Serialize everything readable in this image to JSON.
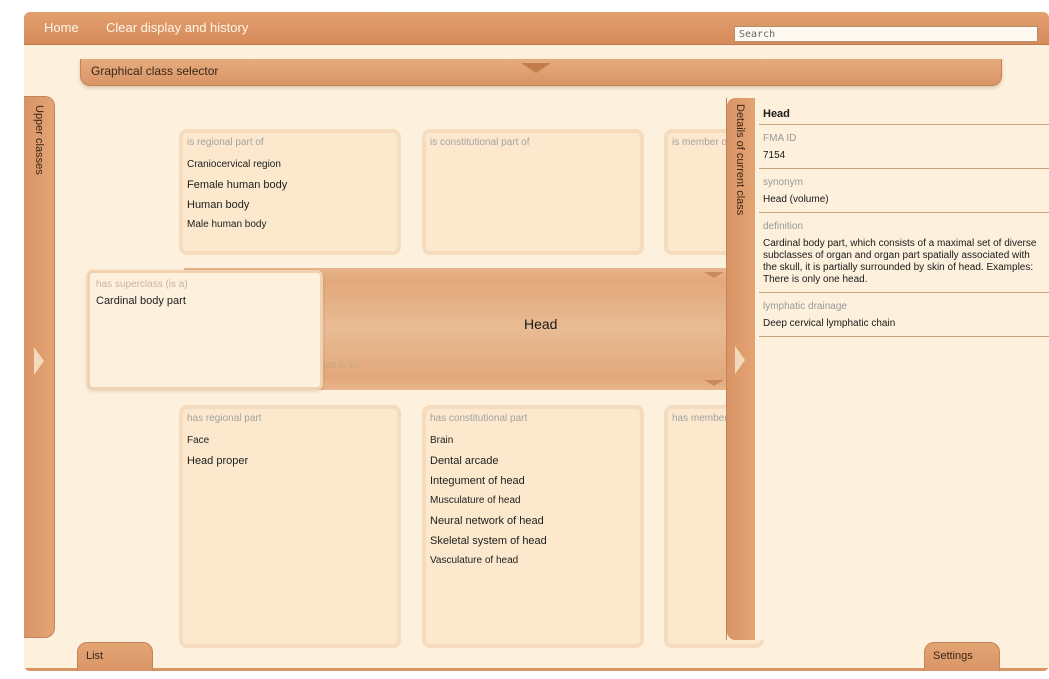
{
  "nav": {
    "home": "Home",
    "clear": "Clear display and history"
  },
  "search": {
    "placeholder": "Search"
  },
  "selector": {
    "label": "Graphical class selector"
  },
  "upper_classes": {
    "label": "Upper classes"
  },
  "top_panels": [
    {
      "title": "is regional part of",
      "items": [
        "Craniocervical region",
        "Female human body",
        "Human body",
        "Male human body"
      ]
    },
    {
      "title": "is constitutional part of",
      "items": []
    },
    {
      "title": "is member of",
      "items": []
    }
  ],
  "bottom_panels": [
    {
      "title": "has regional part",
      "items": [
        "Face",
        "Head proper"
      ]
    },
    {
      "title": "has constitutional part",
      "items": [
        "Brain",
        "Dental arcade",
        "Integument of head",
        "Musculature of head",
        "Neural network of head",
        "Skeletal system of head",
        "Vasculature of head"
      ]
    },
    {
      "title": "has member",
      "items": []
    }
  ],
  "superclass": {
    "title": "has superclass (is a)",
    "value": "Cardinal body part"
  },
  "center": {
    "title": "Head",
    "add_to_list": "Add to list"
  },
  "details": {
    "tab_label": "Details of current class",
    "head": "Head",
    "fma_label": "FMA ID",
    "fma_value": "7154",
    "synonym_label": "synonym",
    "synonym_value": "Head (volume)",
    "definition_label": "definition",
    "definition_value": "Cardinal body part, which consists of a maximal set of diverse subclasses of organ and organ part spatially associated with the skull, it is partially surrounded by skin of head. Examples: There is only one head.",
    "lymph_label": "lymphatic drainage",
    "lymph_value": "Deep cervical lymphatic chain"
  },
  "bottom_tabs": {
    "list": "List",
    "settings": "Settings"
  }
}
